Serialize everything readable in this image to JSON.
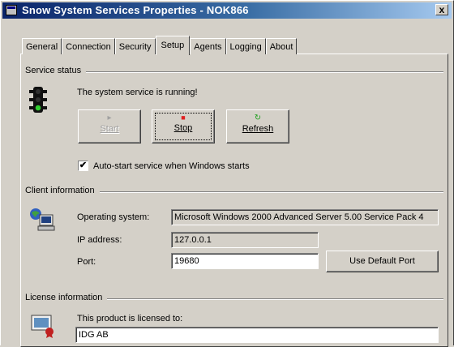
{
  "window": {
    "title": "Snow System Services Properties - NOK866",
    "close_glyph": "x"
  },
  "tabs": [
    {
      "label": "General",
      "active": false
    },
    {
      "label": "Connection",
      "active": false
    },
    {
      "label": "Security",
      "active": false
    },
    {
      "label": "Setup",
      "active": true
    },
    {
      "label": "Agents",
      "active": false
    },
    {
      "label": "Logging",
      "active": false
    },
    {
      "label": "About",
      "active": false
    }
  ],
  "service_status": {
    "group_label": "Service status",
    "message": "The system service is running!",
    "buttons": {
      "start": {
        "label": "Start",
        "glyph": "▸"
      },
      "stop": {
        "label": "Stop",
        "glyph": "■"
      },
      "refresh": {
        "label": "Refresh",
        "glyph": "↻"
      }
    },
    "autostart": {
      "label": "Auto-start service when Windows starts",
      "checked_glyph": "✔"
    }
  },
  "client_info": {
    "group_label": "Client information",
    "os": {
      "label": "Operating system:",
      "value": "Microsoft Windows 2000 Advanced Server 5.00 Service Pack 4"
    },
    "ip": {
      "label": "IP address:",
      "value": "127.0.0.1"
    },
    "port": {
      "label": "Port:",
      "value": "19680"
    },
    "default_port_button": "Use Default Port"
  },
  "license_info": {
    "group_label": "License information",
    "message": "This product is licensed to:",
    "licensee": "IDG AB"
  },
  "colors": {
    "face": "#d4d0c8",
    "title_start": "#0a246a",
    "title_end": "#a6caf0",
    "stop_red": "#e02020",
    "start_gray": "#a0a0a0",
    "refresh_green": "#20a020"
  }
}
